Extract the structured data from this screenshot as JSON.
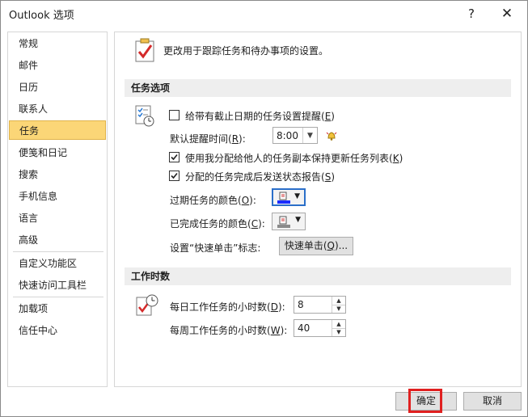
{
  "window": {
    "title": "Outlook 选项",
    "help": "?",
    "close": "✕"
  },
  "sidebar": {
    "items": [
      {
        "label": "常规"
      },
      {
        "label": "邮件"
      },
      {
        "label": "日历"
      },
      {
        "label": "联系人"
      },
      {
        "label": "任务",
        "selected": true
      },
      {
        "label": "便笺和日记"
      },
      {
        "label": "搜索"
      },
      {
        "label": "手机信息"
      },
      {
        "label": "语言"
      },
      {
        "label": "高级"
      },
      {
        "label": "自定义功能区"
      },
      {
        "label": "快速访问工具栏"
      },
      {
        "label": "加载项"
      },
      {
        "label": "信任中心"
      }
    ]
  },
  "main": {
    "header_text": "更改用于跟踪任务和待办事项的设置。",
    "tasks_section": {
      "title": "任务选项",
      "reminder_checkbox": {
        "label": "给带有截止日期的任务设置提醒(",
        "key": "E",
        "suffix": ")",
        "checked": false
      },
      "reminder_time": {
        "label": "默认提醒时间(",
        "key": "R",
        "suffix": "):",
        "value": "8:00"
      },
      "keep_updated": {
        "label": "使用我分配给他人的任务副本保持更新任务列表(",
        "key": "K",
        "suffix": ")",
        "checked": true
      },
      "send_status": {
        "label": "分配的任务完成后发送状态报告(",
        "key": "S",
        "suffix": ")",
        "checked": true
      },
      "overdue_color": {
        "label": "过期任务的颜色(",
        "key": "O",
        "suffix": "):",
        "color": "#1a2cff"
      },
      "completed_color": {
        "label": "已完成任务的颜色(",
        "key": "C",
        "suffix": "):",
        "color": "#8a8a8a"
      },
      "quick_click": {
        "label": "设置“快速单击”标志:",
        "button_label": "快速单击(",
        "button_key": "Q",
        "button_suffix": ")..."
      }
    },
    "work_hours": {
      "title": "工作时数",
      "daily": {
        "label": "每日工作任务的小时数(",
        "key": "D",
        "suffix": "):",
        "value": "8"
      },
      "weekly": {
        "label": "每周工作任务的小时数(",
        "key": "W",
        "suffix": "):",
        "value": "40"
      }
    }
  },
  "footer": {
    "ok_label": "确定",
    "cancel_label": "取消"
  },
  "colors": {
    "selected_bg": "#fbd677",
    "section_bg": "#eeeeee",
    "highlight": "#e02020"
  }
}
